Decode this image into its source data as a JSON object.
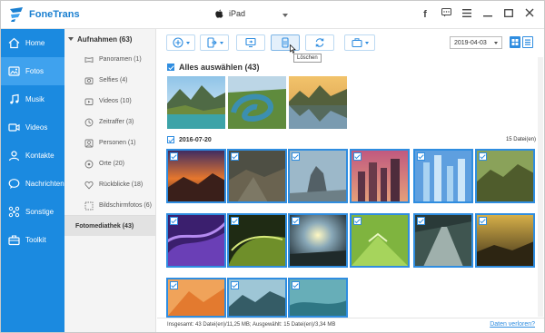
{
  "app": {
    "name": "FoneTrans"
  },
  "device": {
    "name": "iPad"
  },
  "window_controls": [
    "facebook-icon",
    "feedback-icon",
    "menu-icon",
    "minimize-icon",
    "maximize-icon",
    "close-icon"
  ],
  "nav": [
    {
      "key": "home",
      "label": "Home",
      "icon": "home-icon",
      "active": false
    },
    {
      "key": "fotos",
      "label": "Fotos",
      "icon": "photo-icon",
      "active": true
    },
    {
      "key": "musik",
      "label": "Musik",
      "icon": "music-icon",
      "active": false
    },
    {
      "key": "videos",
      "label": "Videos",
      "icon": "video-icon",
      "active": false
    },
    {
      "key": "kontakte",
      "label": "Kontakte",
      "icon": "contact-icon",
      "active": false
    },
    {
      "key": "nachrichten",
      "label": "Nachrichten",
      "icon": "message-icon",
      "active": false
    },
    {
      "key": "sonstige",
      "label": "Sonstige",
      "icon": "other-icon",
      "active": false
    },
    {
      "key": "toolkit",
      "label": "Toolkit",
      "icon": "toolkit-icon",
      "active": false
    }
  ],
  "albums": {
    "header": "Aufnahmen (63)",
    "items": [
      {
        "label": "Panoramen (1)",
        "icon": "panorama-icon"
      },
      {
        "label": "Selfies (4)",
        "icon": "selfie-icon"
      },
      {
        "label": "Videos (10)",
        "icon": "video-icon"
      },
      {
        "label": "Zeitraffer (3)",
        "icon": "timelapse-icon"
      },
      {
        "label": "Personen (1)",
        "icon": "person-icon"
      },
      {
        "label": "Orte (20)",
        "icon": "location-icon"
      },
      {
        "label": "Rückblicke (18)",
        "icon": "memories-icon"
      },
      {
        "label": "Bildschirmfotos (6)",
        "icon": "screenshot-icon"
      }
    ],
    "library": "Fotomediathek (43)"
  },
  "toolbar": {
    "buttons": [
      "add-icon",
      "export-icon",
      "to-pc-icon",
      "delete-icon",
      "convert-icon",
      "toolbox-icon"
    ],
    "tooltip": "Löschen",
    "date_value": "2019-04-03",
    "views": [
      "grid-view-icon",
      "list-view-icon"
    ]
  },
  "content": {
    "select_all": "Alles auswählen (43)",
    "group_date": "2016-07-20",
    "group_count": "15 Datei(en)"
  },
  "status": {
    "text": "Insgesamt: 43 Datei(en)/11,25 MB; Ausgewählt: 15 Datei(en)/3,34 MB",
    "link": "Daten verloren?"
  }
}
